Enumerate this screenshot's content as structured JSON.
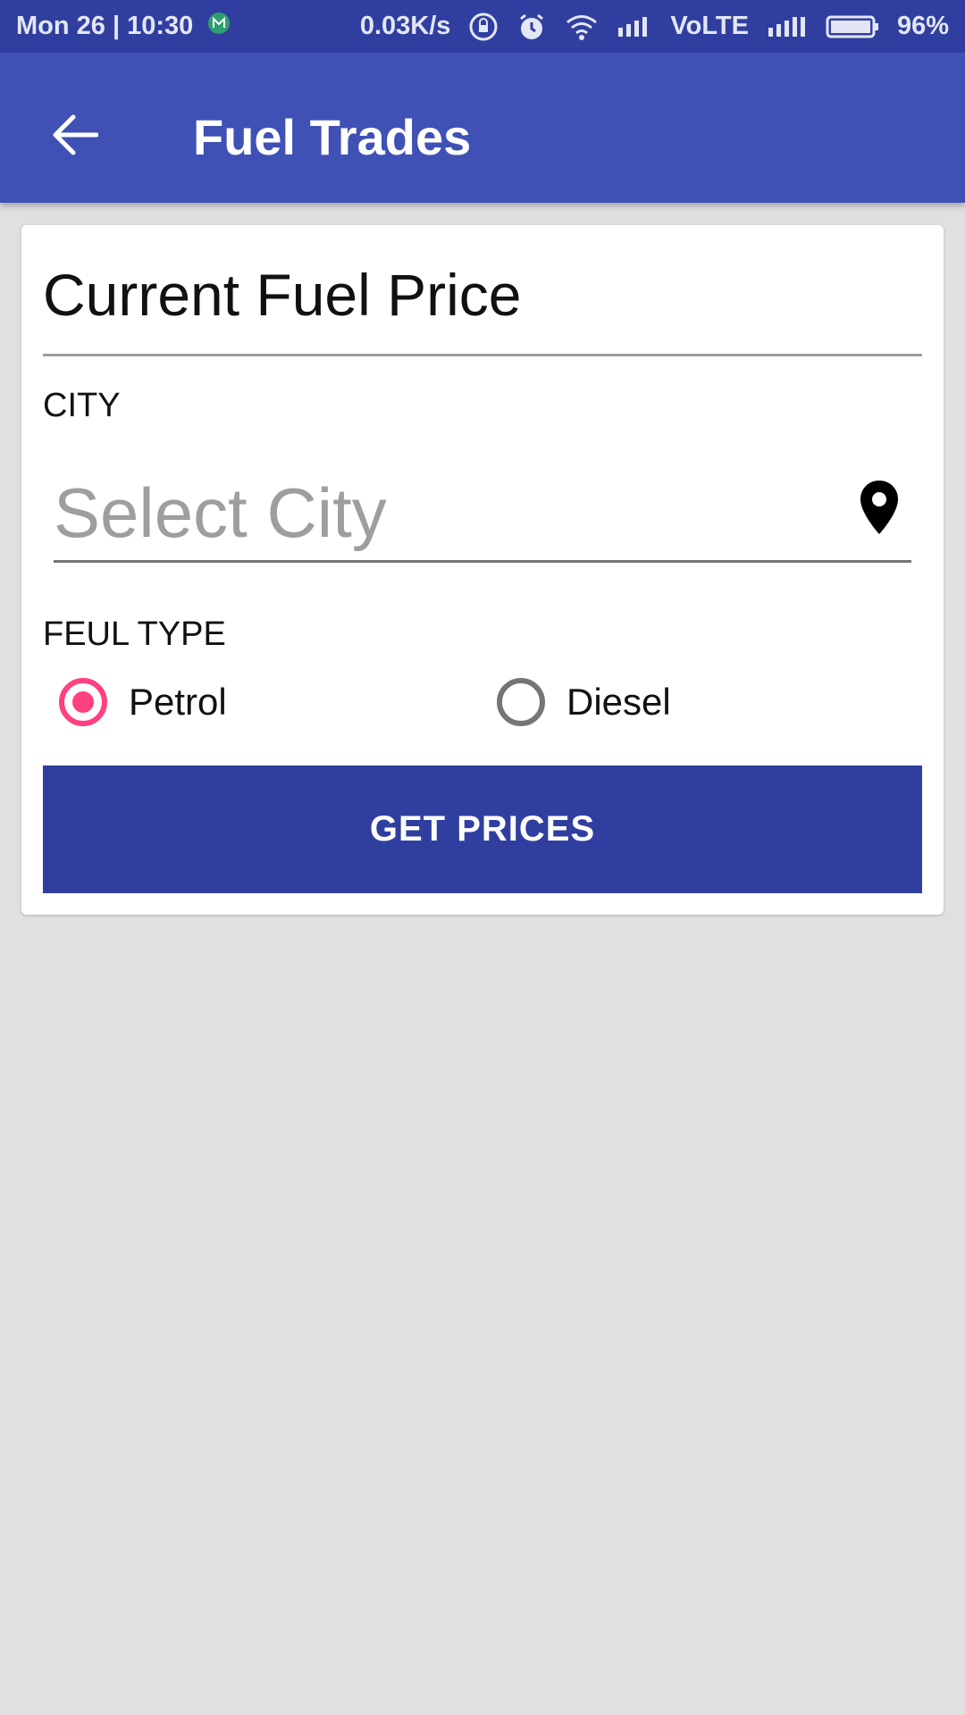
{
  "status_bar": {
    "datetime": "Mon 26 | 10:30",
    "network_speed": "0.03K/s",
    "network_type": "VoLTE",
    "battery": "96%"
  },
  "app_bar": {
    "title": "Fuel Trades"
  },
  "form": {
    "heading": "Current Fuel Price",
    "city_label": "CITY",
    "city_placeholder": "Select City",
    "city_value": "",
    "fuel_type_label": "FEUL TYPE",
    "fuel_options": [
      {
        "label": "Petrol",
        "selected": true
      },
      {
        "label": "Diesel",
        "selected": false
      }
    ],
    "submit_label": "GET PRICES"
  },
  "colors": {
    "primary": "#3f51b5",
    "primary_dark": "#303f9f",
    "accent": "#ff4081",
    "background": "#e0e0e0"
  },
  "icons": {
    "back": "arrow-left-icon",
    "location": "map-pin-icon"
  }
}
